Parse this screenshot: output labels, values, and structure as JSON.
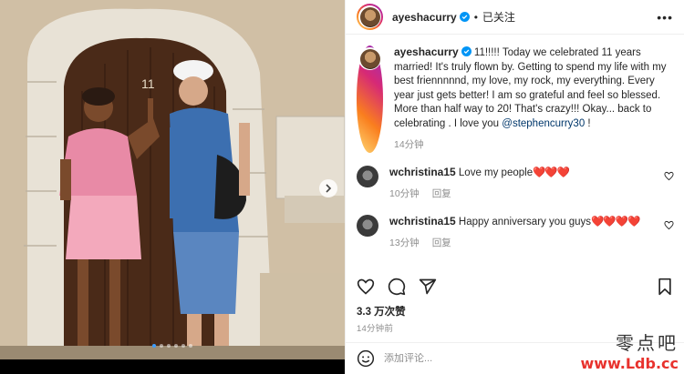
{
  "post": {
    "door_number": "11"
  },
  "header": {
    "username": "ayeshacurry",
    "separator": "•",
    "follow_state": "已关注",
    "more_label": "•••"
  },
  "caption": {
    "username": "ayeshacurry",
    "text": " 11!!!!! Today we celebrated 11 years married! It's truly flown by. Getting to spend my life with my best friennnnnd, my love, my rock, my everything. Every year just gets better! I am so grateful and feel so blessed. More than half way to 20! That's crazy!!! Okay... back to celebrating . I love you ",
    "mention": "@stephencurry30",
    "trailing": " !",
    "time": "14分钟"
  },
  "comments": [
    {
      "username": "wchristina15",
      "text": " Love my people",
      "hearts": "❤️❤️❤️",
      "time": "10分钟",
      "reply_label": "回复"
    },
    {
      "username": "wchristina15",
      "text": " Happy anniversary you guys",
      "hearts": "❤️❤️❤️❤️",
      "time": "13分钟",
      "reply_label": "回复"
    }
  ],
  "stats": {
    "likes": "3.3 万次赞",
    "time_ago": "14分钟前"
  },
  "composer": {
    "placeholder": "添加评论..."
  },
  "carousel": {
    "total": 6,
    "current": 1
  },
  "icons": {
    "verified": "verified-badge-icon",
    "like": "heart-outline-icon",
    "comment": "comment-bubble-icon",
    "share": "paper-plane-icon",
    "save": "bookmark-icon",
    "emoji": "smiley-icon",
    "next": "chevron-right-icon"
  },
  "colors": {
    "verified": "#0095f6",
    "mention": "#00376b",
    "muted": "#8e8e8e",
    "hearts": "#e0245e"
  },
  "watermark": {
    "chinese": "零点吧",
    "url": "www.Ldb.cc"
  }
}
